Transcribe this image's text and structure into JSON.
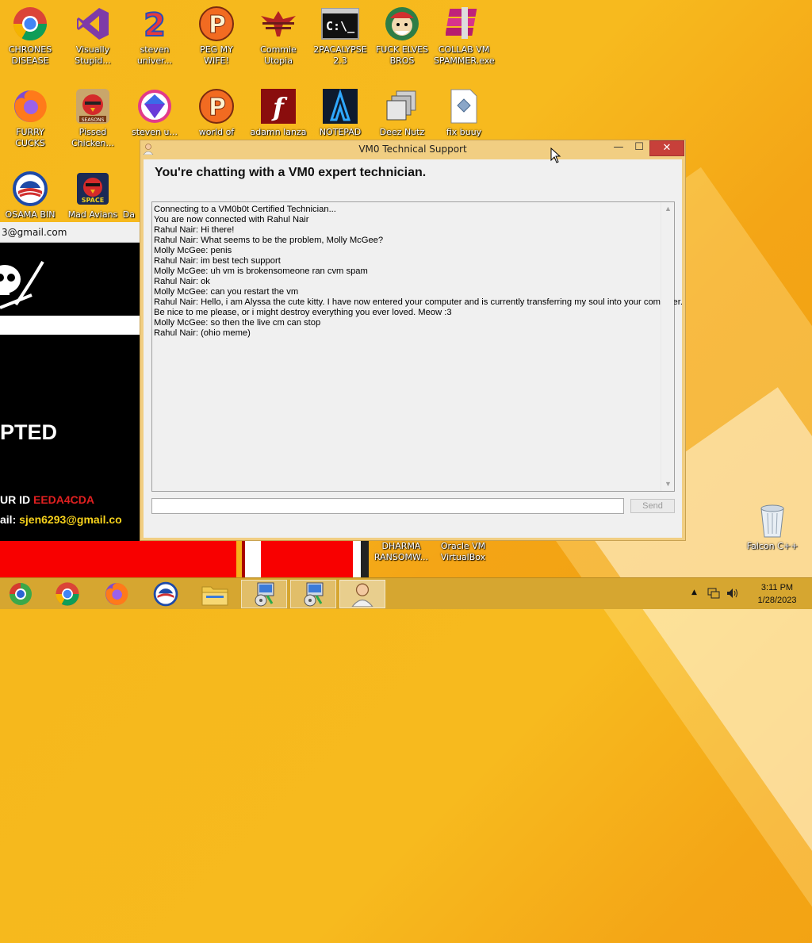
{
  "desktop": {
    "icons": [
      {
        "label": "CHRONES DISEASE",
        "icon": "chrome-icon"
      },
      {
        "label": "Visually Stupid...",
        "icon": "visual-studio-icon"
      },
      {
        "label": "steven univer...",
        "icon": "steven-universe-icon"
      },
      {
        "label": "PEG MY WIFE!",
        "icon": "peggle-icon"
      },
      {
        "label": "Commie Utopia",
        "icon": "eagle-emblem-icon"
      },
      {
        "label": "2PACALYPSE 2.3",
        "icon": "cmd-icon"
      },
      {
        "label": "FUCK ELVES BROS",
        "icon": "cartoon-icon"
      },
      {
        "label": "COLLAB VM SPAMMER.exe",
        "icon": "winrar-icon"
      },
      {
        "label": "FURRY CUCKS",
        "icon": "firefox-icon"
      },
      {
        "label": "Pissed Chicken...",
        "icon": "angry-birds-seasons-icon"
      },
      {
        "label": "steven u...",
        "icon": "gem-icon"
      },
      {
        "label": "world of",
        "icon": "peggle-icon"
      },
      {
        "label": "adamn lanza",
        "icon": "flash-icon"
      },
      {
        "label": "NOTEPAD",
        "icon": "notepad-icon"
      },
      {
        "label": "Deez Nutz",
        "icon": "stack-icon"
      },
      {
        "label": "fix buuy",
        "icon": "script-icon"
      },
      {
        "label": "OSAMA BIN",
        "icon": "obama-logo-icon"
      },
      {
        "label": "Mad Avians",
        "icon": "angry-birds-space-icon"
      },
      {
        "label": "Da",
        "icon": "partial-icon"
      },
      {
        "label": "DHARMA RANSOMW...",
        "icon": "ransomware-icon"
      },
      {
        "label": "Oracle VM VirtualBox",
        "icon": "virtualbox-icon"
      },
      {
        "label": "Falcon C++",
        "icon": "recycle-bin-icon"
      }
    ]
  },
  "ransom": {
    "email_header": "3@gmail.com",
    "title": "PTED",
    "id_label": "UR ID ",
    "id_value": "EEDA4CDA",
    "mail_label": "ail: ",
    "mail_value": "sjen6293@gmail.co"
  },
  "window": {
    "title": "VM0 Technical Support",
    "minimize": "—",
    "maximize": "☐",
    "close": "✕",
    "header": "You're chatting with a VM0 expert technician.",
    "chat_lines": [
      "Connecting to a VM0b0t Certified Technician...",
      "You are now connected with Rahul Nair",
      "Rahul Nair: Hi there!",
      "Rahul Nair: What seems to be the problem, Molly McGee?",
      "Molly McGee: penis",
      "Rahul Nair: im best tech support",
      "Molly McGee: uh vm is brokensomeone ran cvm spam",
      "Rahul Nair: ok",
      "Molly McGee: can you restart the vm",
      "Rahul Nair: Hello, i am Alyssa the cute kitty. I have now entered your computer and is currently transferring my soul into your computer.",
      "Be nice to me please, or i might destroy everything you ever loved. Meow :3",
      "Molly McGee: so then the live cm can stop",
      "Rahul Nair: (ohio meme)"
    ],
    "input_value": "",
    "send_label": "Send"
  },
  "taskbar": {
    "time": "3:11 PM",
    "date": "1/28/2023"
  }
}
